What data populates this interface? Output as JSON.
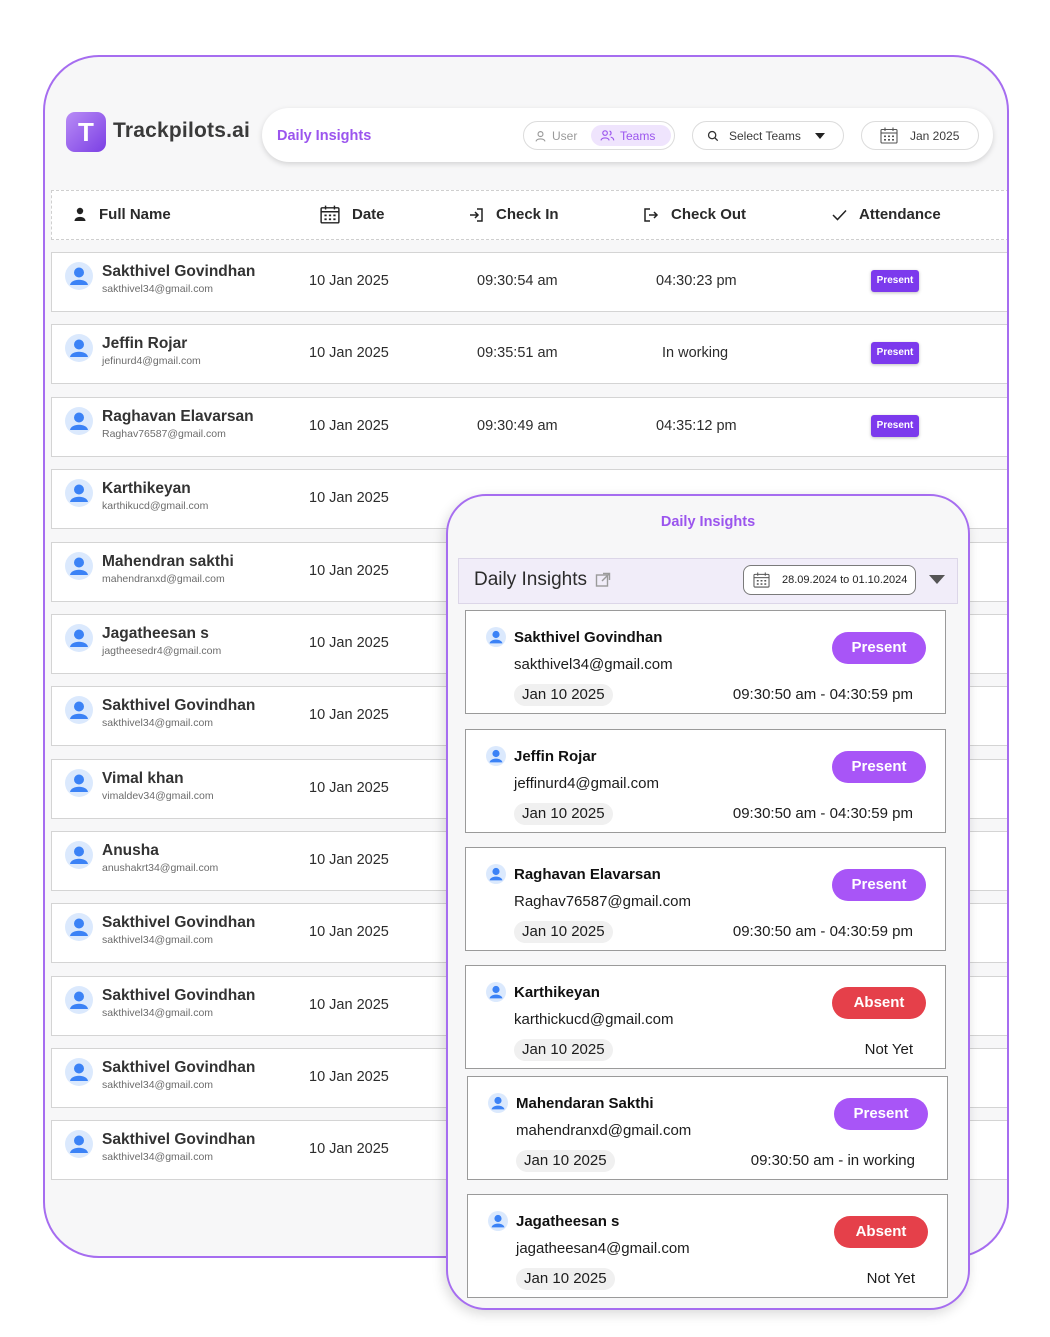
{
  "brand": {
    "name": "Trackpilots.ai",
    "logo_letter": "T"
  },
  "header": {
    "title": "Daily Insights",
    "toggle": {
      "user_label": "User",
      "teams_label": "Teams",
      "active": "Teams"
    },
    "select_teams": {
      "label": "Select Teams"
    },
    "month": {
      "label": "Jan 2025"
    }
  },
  "colors": {
    "accent": "#9b55ee",
    "present": "#7c3aed",
    "absent": "#e5404a",
    "card_present": "#a855f7"
  },
  "table": {
    "columns": {
      "full_name": "Full Name",
      "date": "Date",
      "check_in": "Check In",
      "check_out": "Check Out",
      "attendance": "Attendance"
    },
    "rows": [
      {
        "name": "Sakthivel Govindhan",
        "email": "sakthivel34@gmail.com",
        "date": "10 Jan 2025",
        "check_in": "09:30:54 am",
        "check_out": "04:30:23 pm",
        "status": "Present"
      },
      {
        "name": "Jeffin Rojar",
        "email": "jefinurd4@gmail.com",
        "date": "10 Jan 2025",
        "check_in": "09:35:51 am",
        "check_out": "In working",
        "status": "Present"
      },
      {
        "name": "Raghavan Elavarsan",
        "email": "Raghav76587@gmail.com",
        "date": "10 Jan 2025",
        "check_in": "09:30:49 am",
        "check_out": "04:35:12 pm",
        "status": "Present"
      },
      {
        "name": "Karthikeyan",
        "email": "karthikucd@gmail.com",
        "date": "10 Jan 2025",
        "check_in": "",
        "check_out": "",
        "status": ""
      },
      {
        "name": "Mahendran sakthi",
        "email": "mahendranxd@gmail.com",
        "date": "10 Jan 2025",
        "check_in": "",
        "check_out": "",
        "status": ""
      },
      {
        "name": "Jagatheesan s",
        "email": "jagtheesedr4@gmail.com",
        "date": "10 Jan 2025",
        "check_in": "",
        "check_out": "",
        "status": ""
      },
      {
        "name": "Sakthivel Govindhan",
        "email": "sakthivel34@gmail.com",
        "date": "10 Jan 2025",
        "check_in": "",
        "check_out": "",
        "status": ""
      },
      {
        "name": "Vimal khan",
        "email": "vimaldev34@gmail.com",
        "date": "10 Jan 2025",
        "check_in": "",
        "check_out": "",
        "status": ""
      },
      {
        "name": "Anusha",
        "email": "anushakrt34@gmail.com",
        "date": "10 Jan 2025",
        "check_in": "",
        "check_out": "",
        "status": ""
      },
      {
        "name": "Sakthivel Govindhan",
        "email": "sakthivel34@gmail.com",
        "date": "10 Jan 2025",
        "check_in": "",
        "check_out": "",
        "status": ""
      },
      {
        "name": "Sakthivel Govindhan",
        "email": "sakthivel34@gmail.com",
        "date": "10 Jan 2025",
        "check_in": "",
        "check_out": "",
        "status": ""
      },
      {
        "name": "Sakthivel Govindhan",
        "email": "sakthivel34@gmail.com",
        "date": "10 Jan 2025",
        "check_in": "",
        "check_out": "",
        "status": ""
      },
      {
        "name": "Sakthivel Govindhan",
        "email": "sakthivel34@gmail.com",
        "date": "10 Jan 2025",
        "check_in": "",
        "check_out": "",
        "status": ""
      }
    ]
  },
  "mobile": {
    "title": "Daily Insights",
    "panel_title": "Daily Insights",
    "date_range": "28.09.2024 to 01.10.2024",
    "cards": [
      {
        "name": "Sakthivel Govindhan",
        "email": "sakthivel34@gmail.com",
        "date": "Jan 10 2025",
        "time": "09:30:50 am - 04:30:59 pm",
        "status": "Present"
      },
      {
        "name": "Jeffin Rojar",
        "email": "jeffinurd4@gmail.com",
        "date": "Jan 10 2025",
        "time": "09:30:50 am - 04:30:59 pm",
        "status": "Present"
      },
      {
        "name": "Raghavan Elavarsan",
        "email": "Raghav76587@gmail.com",
        "date": "Jan 10 2025",
        "time": "09:30:50 am - 04:30:59 pm",
        "status": "Present"
      },
      {
        "name": "Karthikeyan",
        "email": "karthickucd@gmail.com",
        "date": "Jan 10 2025",
        "time": "Not Yet",
        "status": "Absent"
      },
      {
        "name": "Mahendaran Sakthi",
        "email": "mahendranxd@gmail.com",
        "date": "Jan 10 2025",
        "time": "09:30:50 am - in working",
        "status": "Present"
      },
      {
        "name": "Jagatheesan  s",
        "email": "jagatheesan4@gmail.com",
        "date": "Jan 10 2025",
        "time": "Not Yet",
        "status": "Absent"
      }
    ]
  }
}
